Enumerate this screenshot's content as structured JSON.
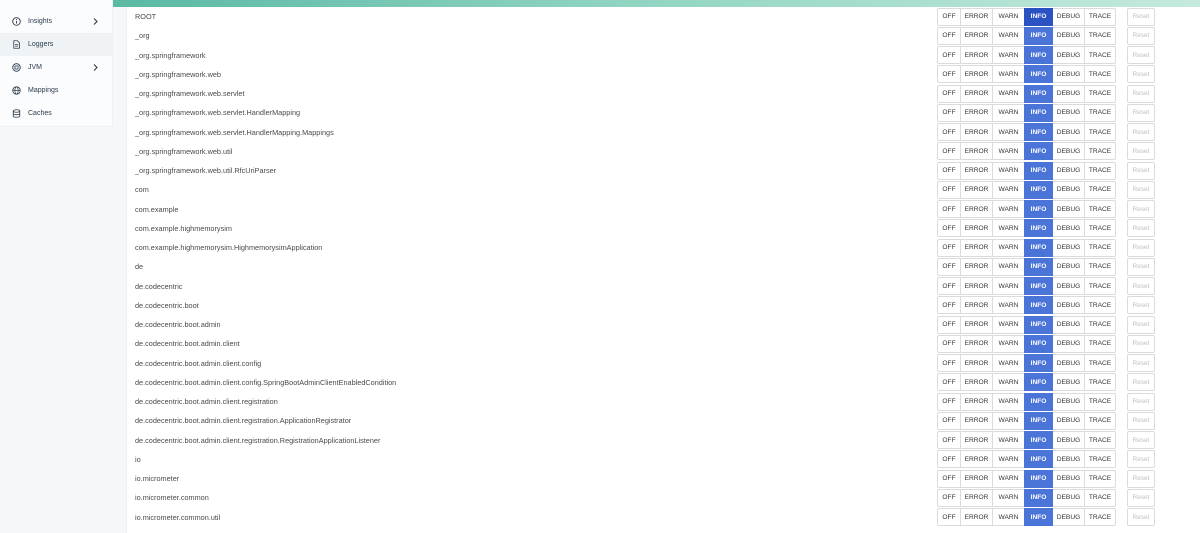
{
  "sidebar": {
    "items": [
      {
        "label": "Insights",
        "icon": "info-circle-icon",
        "has_chevron": true
      },
      {
        "label": "Loggers",
        "icon": "document-icon",
        "has_chevron": false,
        "active": true
      },
      {
        "label": "JVM",
        "icon": "cpu-circle-icon",
        "has_chevron": true
      },
      {
        "label": "Mappings",
        "icon": "globe-icon",
        "has_chevron": false
      },
      {
        "label": "Caches",
        "icon": "database-icon",
        "has_chevron": false
      }
    ]
  },
  "levels": [
    "OFF",
    "ERROR",
    "WARN",
    "INFO",
    "DEBUG",
    "TRACE"
  ],
  "reset_label": "Reset",
  "colors": {
    "active_level": "#4a74d8",
    "active_level_configured": "#2a52c2",
    "accent_bar": "#5ab9a3"
  },
  "loggers": [
    {
      "name": "ROOT",
      "level": "INFO",
      "configured": true
    },
    {
      "name": "_org",
      "level": "INFO"
    },
    {
      "name": "_org.springframework",
      "level": "INFO"
    },
    {
      "name": "_org.springframework.web",
      "level": "INFO"
    },
    {
      "name": "_org.springframework.web.servlet",
      "level": "INFO"
    },
    {
      "name": "_org.springframework.web.servlet.HandlerMapping",
      "level": "INFO"
    },
    {
      "name": "_org.springframework.web.servlet.HandlerMapping.Mappings",
      "level": "INFO"
    },
    {
      "name": "_org.springframework.web.util",
      "level": "INFO"
    },
    {
      "name": "_org.springframework.web.util.RfcUriParser",
      "level": "INFO"
    },
    {
      "name": "com",
      "level": "INFO"
    },
    {
      "name": "com.example",
      "level": "INFO"
    },
    {
      "name": "com.example.highmemorysim",
      "level": "INFO"
    },
    {
      "name": "com.example.highmemorysim.HighmemorysimApplication",
      "level": "INFO"
    },
    {
      "name": "de",
      "level": "INFO"
    },
    {
      "name": "de.codecentric",
      "level": "INFO"
    },
    {
      "name": "de.codecentric.boot",
      "level": "INFO"
    },
    {
      "name": "de.codecentric.boot.admin",
      "level": "INFO"
    },
    {
      "name": "de.codecentric.boot.admin.client",
      "level": "INFO"
    },
    {
      "name": "de.codecentric.boot.admin.client.config",
      "level": "INFO"
    },
    {
      "name": "de.codecentric.boot.admin.client.config.SpringBootAdminClientEnabledCondition",
      "level": "INFO"
    },
    {
      "name": "de.codecentric.boot.admin.client.registration",
      "level": "INFO"
    },
    {
      "name": "de.codecentric.boot.admin.client.registration.ApplicationRegistrator",
      "level": "INFO"
    },
    {
      "name": "de.codecentric.boot.admin.client.registration.RegistrationApplicationListener",
      "level": "INFO"
    },
    {
      "name": "io",
      "level": "INFO"
    },
    {
      "name": "io.micrometer",
      "level": "INFO"
    },
    {
      "name": "io.micrometer.common",
      "level": "INFO"
    },
    {
      "name": "io.micrometer.common.util",
      "level": "INFO"
    }
  ]
}
